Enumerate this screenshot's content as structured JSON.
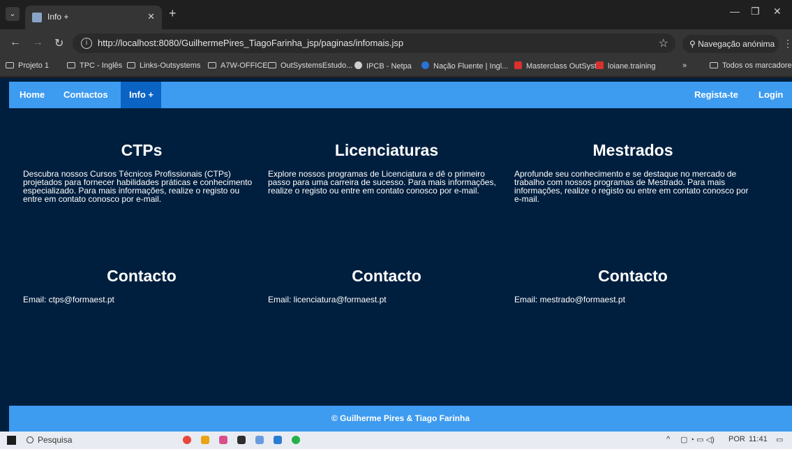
{
  "browser": {
    "tab_title": "Info +",
    "url": "http://localhost:8080/GuilhermePires_TiagoFarinha_jsp/paginas/infomais.jsp",
    "incognito_label": "Navegação anónima",
    "bookmarks": [
      "Projeto 1",
      "TPC - Inglês",
      "Links-Outsystems",
      "A7W-OFFICE",
      "OutSystemsEstudo...",
      "IPCB - Netpa",
      "Nação Fluente | Ingl...",
      "Masterclass OutSyst...",
      "loiane.training"
    ],
    "all_bookmarks": "Todos os marcadores"
  },
  "nav": {
    "home": "Home",
    "contactos": "Contactos",
    "info": "Info +",
    "registo": "Regista-te",
    "login": "Login"
  },
  "sections": [
    {
      "title": "CTPs",
      "text": "Descubra nossos Cursos Técnicos Profissionais (CTPs) projetados para fornecer habilidades práticas e conhecimento especializado. Para mais informações, realize o registo ou entre em contato conosco por e-mail.",
      "contact_title": "Contacto",
      "email": "Email: ctps@formaest.pt"
    },
    {
      "title": "Licenciaturas",
      "text": "Explore nossos programas de Licenciatura e dê o primeiro passo para uma carreira de sucesso. Para mais informações, realize o registo ou entre em contato conosco por e-mail.",
      "contact_title": "Contacto",
      "email": "Email: licenciatura@formaest.pt"
    },
    {
      "title": "Mestrados",
      "text": "Aprofunde seu conhecimento e se destaque no mercado de trabalho com nossos programas de Mestrado. Para mais informações, realize o registo ou entre em contato conosco por e-mail.",
      "contact_title": "Contacto",
      "email": "Email: mestrado@formaest.pt"
    }
  ],
  "footer": "© Guilherme Pires & Tiago Farinha",
  "taskbar": {
    "search": "Pesquisa",
    "lang": "POR",
    "time": "11:41"
  }
}
